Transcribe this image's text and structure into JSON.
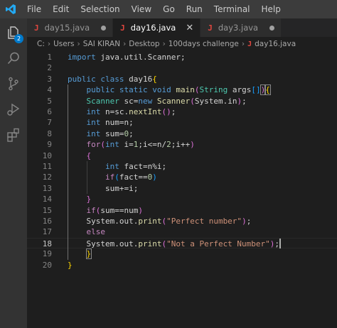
{
  "menu": [
    "File",
    "Edit",
    "Selection",
    "View",
    "Go",
    "Run",
    "Terminal",
    "Help"
  ],
  "activity": {
    "explorer_badge": "2"
  },
  "tabs": [
    {
      "label": "day15.java",
      "state": "modified"
    },
    {
      "label": "day16.java",
      "state": "active"
    },
    {
      "label": "day3.java",
      "state": "modified"
    }
  ],
  "breadcrumb": [
    "C:",
    "Users",
    "SAI KIRAN",
    "Desktop",
    "100days challenge",
    "day16.java"
  ],
  "editor": {
    "current_line": 18,
    "line_numbers": [
      "1",
      "2",
      "3",
      "4",
      "5",
      "6",
      "7",
      "8",
      "9",
      "10",
      "11",
      "12",
      "13",
      "14",
      "15",
      "16",
      "17",
      "18",
      "19",
      "20"
    ],
    "lines": [
      [
        [
          "kw",
          "import"
        ],
        [
          "p",
          " java.util.Scanner;"
        ]
      ],
      [],
      [
        [
          "kw",
          "public"
        ],
        [
          "p",
          " "
        ],
        [
          "kw",
          "class"
        ],
        [
          "p",
          " day16"
        ],
        [
          "b1",
          "{"
        ]
      ],
      [
        [
          "p",
          "    "
        ],
        [
          "kw",
          "public"
        ],
        [
          "p",
          " "
        ],
        [
          "kw",
          "static"
        ],
        [
          "p",
          " "
        ],
        [
          "kw",
          "void"
        ],
        [
          "p",
          " "
        ],
        [
          "fn",
          "main"
        ],
        [
          "b2",
          "("
        ],
        [
          "ty",
          "String"
        ],
        [
          "p",
          " args"
        ],
        [
          "b3",
          "[]"
        ],
        [
          "b2",
          "bm",
          ")"
        ],
        [
          "b1",
          "bm",
          "{"
        ]
      ],
      [
        [
          "p",
          "    "
        ],
        [
          "ty",
          "Scanner"
        ],
        [
          "p",
          " sc="
        ],
        [
          "kw",
          "new"
        ],
        [
          "p",
          " "
        ],
        [
          "fn",
          "Scanner"
        ],
        [
          "b2",
          "("
        ],
        [
          "p",
          "System.in"
        ],
        [
          "b2",
          ")"
        ],
        [
          "p",
          ";"
        ]
      ],
      [
        [
          "p",
          "    "
        ],
        [
          "kw",
          "int"
        ],
        [
          "p",
          " n=sc."
        ],
        [
          "fn",
          "nextInt"
        ],
        [
          "b2",
          "()"
        ],
        [
          "p",
          ";"
        ]
      ],
      [
        [
          "p",
          "    "
        ],
        [
          "kw",
          "int"
        ],
        [
          "p",
          " num=n;"
        ]
      ],
      [
        [
          "p",
          "    "
        ],
        [
          "kw",
          "int"
        ],
        [
          "p",
          " sum="
        ],
        [
          "nm",
          "0"
        ],
        [
          "p",
          ";"
        ]
      ],
      [
        [
          "p",
          "    "
        ],
        [
          "ctl",
          "for"
        ],
        [
          "b2",
          "("
        ],
        [
          "kw",
          "int"
        ],
        [
          "p",
          " i="
        ],
        [
          "nm",
          "1"
        ],
        [
          "p",
          ";i<=n/"
        ],
        [
          "nm",
          "2"
        ],
        [
          "p",
          ";i++"
        ],
        [
          "b2",
          ")"
        ]
      ],
      [
        [
          "p",
          "    "
        ],
        [
          "b2",
          "{"
        ]
      ],
      [
        [
          "p",
          "        "
        ],
        [
          "kw",
          "int"
        ],
        [
          "p",
          " fact=n%i;"
        ]
      ],
      [
        [
          "p",
          "        "
        ],
        [
          "ctl",
          "if"
        ],
        [
          "b3",
          "("
        ],
        [
          "p",
          "fact=="
        ],
        [
          "nm",
          "0"
        ],
        [
          "b3",
          ")"
        ]
      ],
      [
        [
          "p",
          "        sum+=i;"
        ]
      ],
      [
        [
          "p",
          "    "
        ],
        [
          "b2",
          "}"
        ]
      ],
      [
        [
          "p",
          "    "
        ],
        [
          "ctl",
          "if"
        ],
        [
          "b2",
          "("
        ],
        [
          "p",
          "sum==num"
        ],
        [
          "b2",
          ")"
        ]
      ],
      [
        [
          "p",
          "    System.out."
        ],
        [
          "fn",
          "print"
        ],
        [
          "b2",
          "("
        ],
        [
          "st",
          "\"Perfect number\""
        ],
        [
          "b2",
          ")"
        ],
        [
          "p",
          ";"
        ]
      ],
      [
        [
          "p",
          "    "
        ],
        [
          "ctl",
          "else"
        ]
      ],
      [
        [
          "p",
          "    System.out."
        ],
        [
          "fn",
          "print"
        ],
        [
          "b2",
          "("
        ],
        [
          "st",
          "\"Not a Perfect Number\""
        ],
        [
          "b2",
          ")"
        ],
        [
          "p",
          ";"
        ]
      ],
      [
        [
          "p",
          "    "
        ],
        [
          "b1",
          "bm",
          "}"
        ]
      ],
      [
        [
          "b1",
          "}"
        ]
      ]
    ]
  }
}
